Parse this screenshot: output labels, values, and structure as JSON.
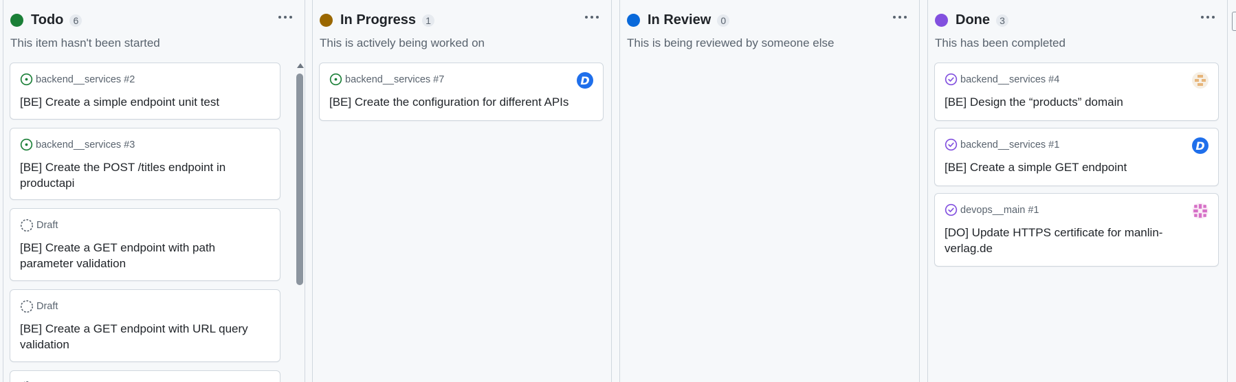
{
  "columns": [
    {
      "title": "Todo",
      "count": "6",
      "color": "#1a7f37",
      "description": "This item hasn't been started",
      "cards": [
        {
          "ref": "backend__services #2",
          "title": "[BE] Create a simple endpoint unit test",
          "icon": "issue-open-icon",
          "avatar": ""
        },
        {
          "ref": "backend__services #3",
          "title": "[BE] Create the POST /titles endpoint in productapi",
          "icon": "issue-open-icon",
          "avatar": ""
        },
        {
          "ref": "Draft",
          "title": "[BE] Create a GET endpoint with path parameter validation",
          "icon": "draft-icon",
          "avatar": ""
        },
        {
          "ref": "Draft",
          "title": "[BE] Create a GET endpoint with URL query validation",
          "icon": "draft-icon",
          "avatar": ""
        }
      ]
    },
    {
      "title": "In Progress",
      "count": "1",
      "color": "#9a6700",
      "description": "This is actively being worked on",
      "cards": [
        {
          "ref": "backend__services #7",
          "title": "[BE] Create the configuration for different APIs",
          "icon": "issue-open-icon",
          "avatar": "D"
        }
      ]
    },
    {
      "title": "In Review",
      "count": "0",
      "color": "#0969da",
      "description": "This is being reviewed by someone else",
      "cards": []
    },
    {
      "title": "Done",
      "count": "3",
      "color": "#8250df",
      "description": "This has been completed",
      "cards": [
        {
          "ref": "backend__services #4",
          "title": "[BE] Design the “products” domain",
          "icon": "issue-closed-icon",
          "avatar": "identicon-tan"
        },
        {
          "ref": "backend__services #1",
          "title": "[BE] Create a simple GET endpoint",
          "icon": "issue-closed-icon",
          "avatar": "D"
        },
        {
          "ref": "devops__main #1",
          "title": "[DO] Update HTTPS certificate for manlin-verlag.de",
          "icon": "issue-closed-icon",
          "avatar": "identicon-pink"
        }
      ]
    }
  ],
  "colors": {
    "open": "#1a7f37",
    "closed": "#8250df",
    "draft": "#59636e"
  }
}
